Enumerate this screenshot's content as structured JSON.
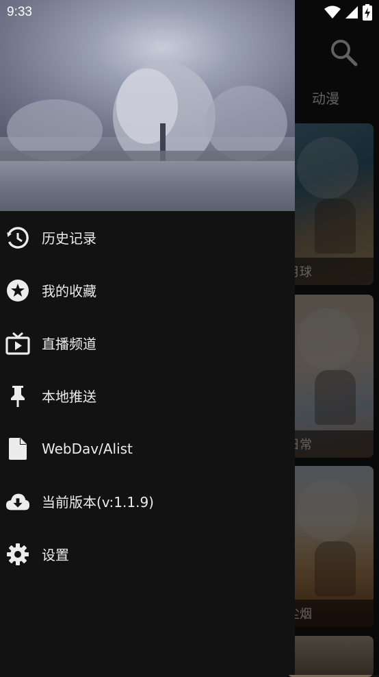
{
  "status_bar": {
    "time": "9:33"
  },
  "background_app": {
    "visible_tab": "动漫",
    "posters": [
      {
        "title_fragment": "月球"
      },
      {
        "title_fragment": "日常"
      },
      {
        "title_fragment": "尘烟"
      }
    ]
  },
  "drawer": {
    "menu": [
      {
        "label": "历史记录",
        "icon": "history-icon"
      },
      {
        "label": "我的收藏",
        "icon": "star-icon"
      },
      {
        "label": "直播频道",
        "icon": "live-tv-icon"
      },
      {
        "label": "本地推送",
        "icon": "pin-icon"
      },
      {
        "label": "WebDav/Alist",
        "icon": "file-icon"
      },
      {
        "label": "当前版本(v:1.1.9)",
        "icon": "cloud-download-icon"
      },
      {
        "label": "设置",
        "icon": "gear-icon"
      }
    ]
  },
  "colors": {
    "drawer_background": "#121212",
    "text": "#ececec",
    "scrim": "rgba(0,0,0,0.62)"
  }
}
